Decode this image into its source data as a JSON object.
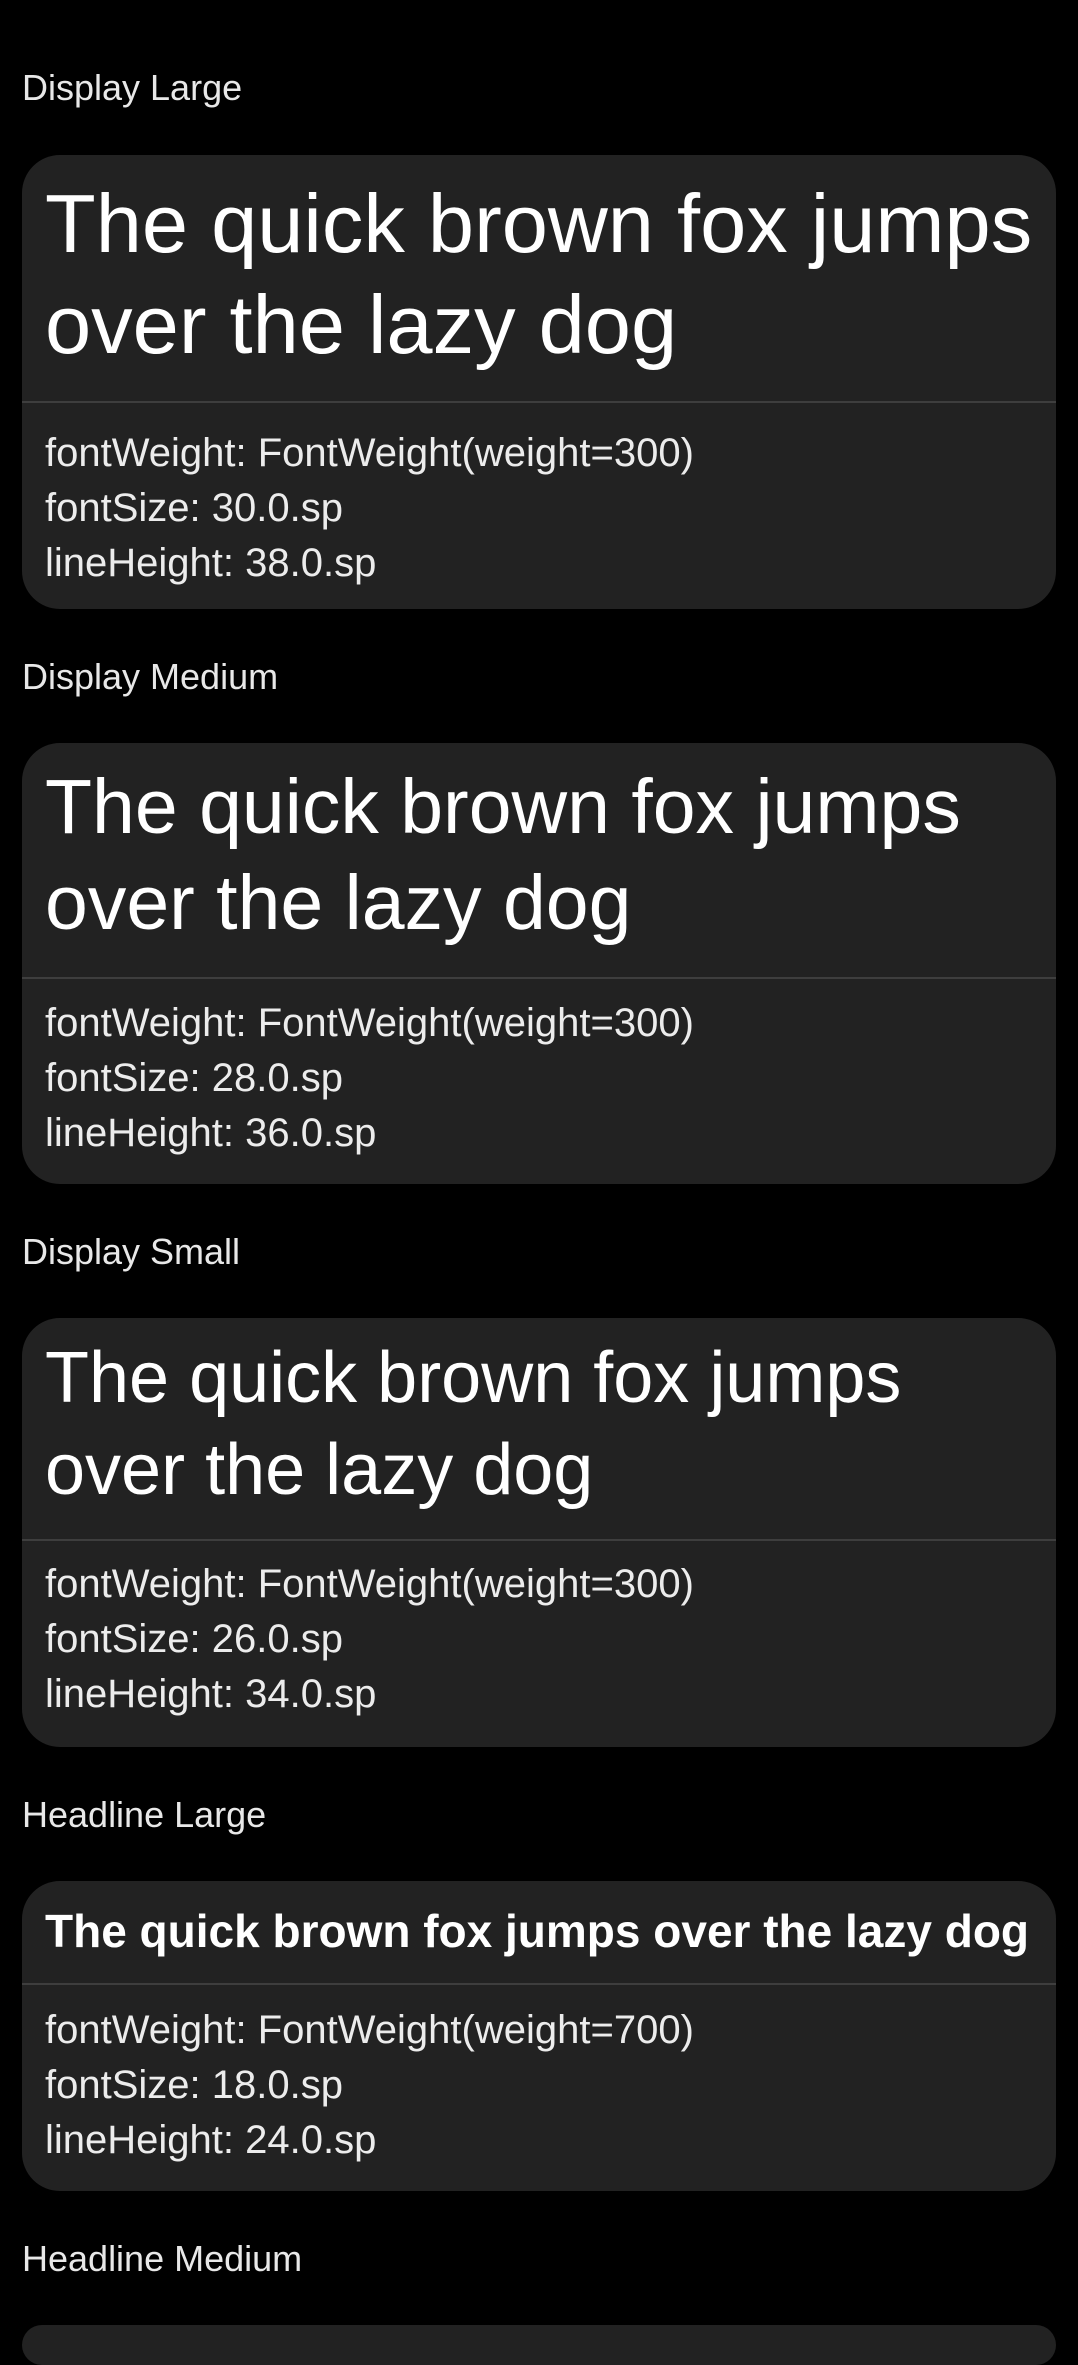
{
  "sample_text": "The quick brown fox jumps over the lazy dog",
  "colors": {
    "background": "#000000",
    "card": "#222222",
    "divider": "#3e3e3e",
    "text": "#ffffff"
  },
  "styles": [
    {
      "name": "Display Large",
      "font_weight": "fontWeight: FontWeight(weight=300)",
      "font_size": "fontSize: 30.0.sp",
      "line_height": "lineHeight: 38.0.sp"
    },
    {
      "name": "Display Medium",
      "font_weight": "fontWeight: FontWeight(weight=300)",
      "font_size": "fontSize: 28.0.sp",
      "line_height": "lineHeight: 36.0.sp"
    },
    {
      "name": "Display Small",
      "font_weight": "fontWeight: FontWeight(weight=300)",
      "font_size": "fontSize: 26.0.sp",
      "line_height": "lineHeight: 34.0.sp"
    },
    {
      "name": "Headline Large",
      "font_weight": "fontWeight: FontWeight(weight=700)",
      "font_size": "fontSize: 18.0.sp",
      "line_height": "lineHeight: 24.0.sp"
    },
    {
      "name": "Headline Medium"
    }
  ]
}
